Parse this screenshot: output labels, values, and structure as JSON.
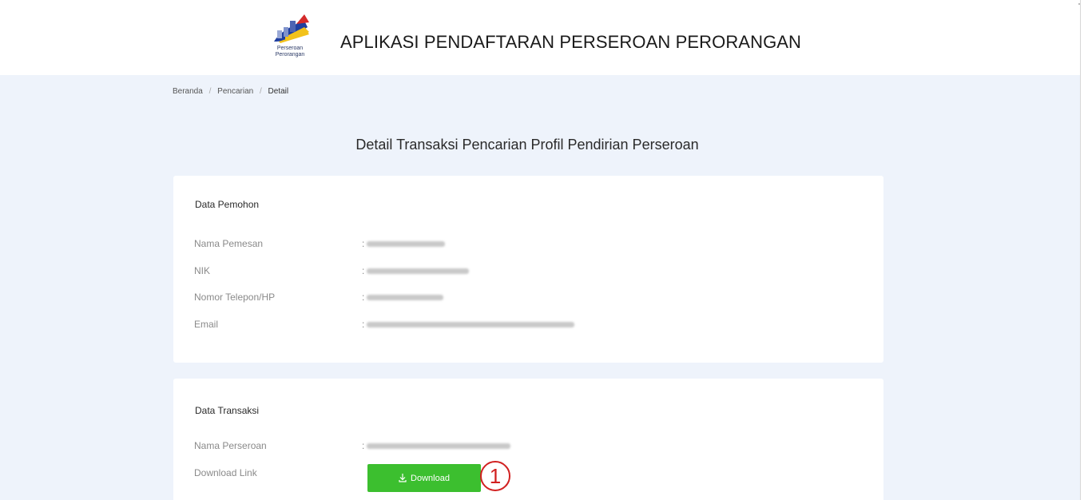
{
  "header": {
    "title": "APLIKASI PENDAFTARAN PERSEROAN PERORANGAN",
    "logo_caption_line1": "Perseroan",
    "logo_caption_line2": "Perorangan"
  },
  "breadcrumb": {
    "items": [
      "Beranda",
      "Pencarian",
      "Detail"
    ],
    "separator": "/"
  },
  "page_title": "Detail Transaksi Pencarian Profil Pendirian Perseroan",
  "data_pemohon": {
    "title": "Data Pemohon",
    "rows": [
      {
        "label": "Nama Pemesan",
        "colon": ":"
      },
      {
        "label": "NIK",
        "colon": ":"
      },
      {
        "label": "Nomor Telepon/HP",
        "colon": ":"
      },
      {
        "label": "Email",
        "colon": ":"
      }
    ]
  },
  "data_transaksi": {
    "title": "Data Transaksi",
    "rows": [
      {
        "label": "Nama Perseroan",
        "colon": ":"
      },
      {
        "label": "Download Link"
      }
    ],
    "download_label": "Download"
  },
  "annotation": {
    "marker": "1"
  },
  "colors": {
    "main_background": "#eef3fb",
    "card_background": "#ffffff",
    "button_green": "#3cbf2f",
    "marker_red": "#d12020"
  },
  "icons": [
    "logo-icon",
    "download-icon"
  ]
}
